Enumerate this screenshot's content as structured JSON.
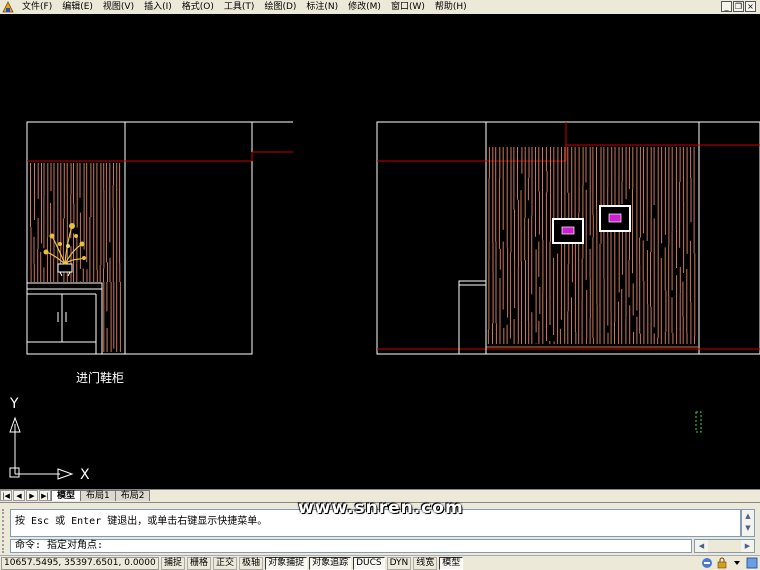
{
  "menu": {
    "items": [
      {
        "label": "文件(F)"
      },
      {
        "label": "编辑(E)"
      },
      {
        "label": "视图(V)"
      },
      {
        "label": "插入(I)"
      },
      {
        "label": "格式(O)"
      },
      {
        "label": "工具(T)"
      },
      {
        "label": "绘图(D)"
      },
      {
        "label": "标注(N)"
      },
      {
        "label": "修改(M)"
      },
      {
        "label": "窗口(W)"
      },
      {
        "label": "帮助(H)"
      }
    ],
    "window_buttons": [
      "_",
      "❐",
      "×"
    ]
  },
  "drawing": {
    "left_view_caption": "进门鞋柜",
    "ucs_y_label": "Y",
    "ucs_x_label": "X",
    "colors": {
      "background": "#000000",
      "white_line": "#ffffff",
      "red_line": "#c80000",
      "wood_line": "#c8785a",
      "picture_fill": "#d01fd0",
      "plant_yellow": "#e8c040"
    }
  },
  "tabs": {
    "nav": [
      "|◀",
      "◀",
      "▶",
      "▶|"
    ],
    "items": [
      {
        "label": "模型",
        "active": true
      },
      {
        "label": "布局1",
        "active": false
      },
      {
        "label": "布局2",
        "active": false
      }
    ]
  },
  "command": {
    "history_text": "按 Esc 或 Enter 键退出，或单击右键显示快捷菜单。",
    "prompt_text": "命令: 指定对角点:"
  },
  "watermark": "www.snren.com",
  "status": {
    "coordinates": "10657.5495, 35397.6501, 0.0000",
    "toggles": [
      {
        "label": "捕捉",
        "on": false
      },
      {
        "label": "栅格",
        "on": false
      },
      {
        "label": "正交",
        "on": false
      },
      {
        "label": "极轴",
        "on": false
      },
      {
        "label": "对象捕捉",
        "on": true
      },
      {
        "label": "对象追踪",
        "on": true
      },
      {
        "label": "DUCS",
        "on": true
      },
      {
        "label": "DYN",
        "on": false
      },
      {
        "label": "线宽",
        "on": false
      },
      {
        "label": "模型",
        "on": true
      }
    ]
  }
}
